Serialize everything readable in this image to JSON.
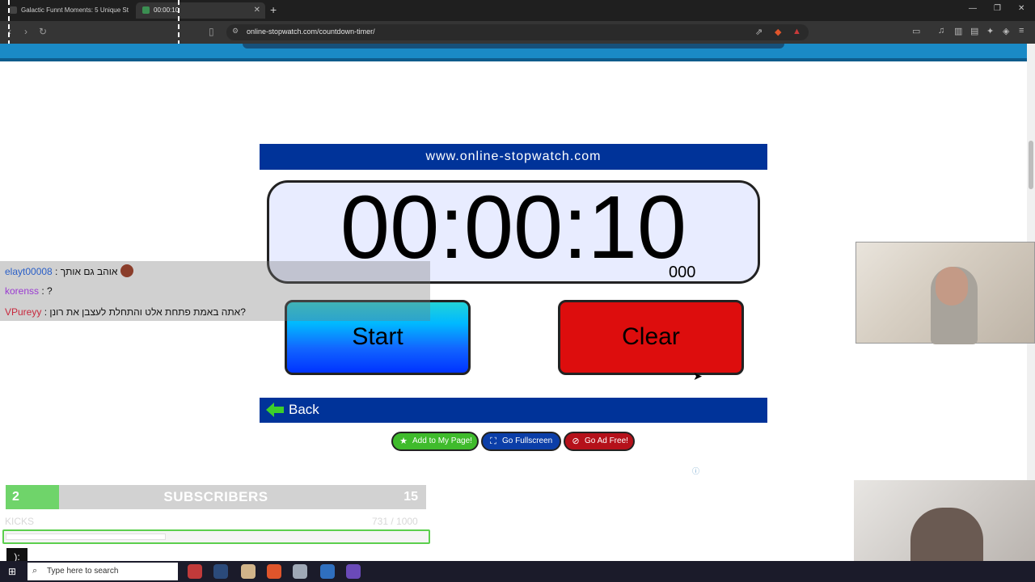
{
  "browser": {
    "tabs": [
      {
        "title": "Galactic Funnt Moments: 5 Unique St"
      },
      {
        "title": "00:00:10"
      }
    ],
    "new_tab_icon": "plus-icon",
    "url": "online-stopwatch.com/countdown-timer/"
  },
  "stopwatch": {
    "site_name": "www.online-stopwatch.com",
    "time": "00:00:10",
    "milliseconds": "000",
    "start_label": "Start",
    "clear_label": "Clear",
    "back_label": "Back",
    "add_label": "Add to My Page!",
    "fullscreen_label": "Go Fullscreen",
    "adfree_label": "Go Ad Free!",
    "colors": {
      "header": "#003399",
      "clear": "#dd0d0d",
      "start_top": "#22d3d8",
      "start_bottom": "#0033ff"
    }
  },
  "chat": {
    "messages": [
      {
        "nick": "elayt00008",
        "text": " : אוהב גם אותך",
        "nick_color": "#2a5fc7"
      },
      {
        "nick": "korenss",
        "text": " : ?",
        "nick_color": "#9a3bd1"
      },
      {
        "nick": "VPureyy",
        "text": " : אתה באמת פתחת אלט והתחלת לעצבן את רונן?",
        "nick_color": "#c8283d"
      }
    ]
  },
  "subscribers": {
    "current": "2",
    "label": "SUBSCRIBERS",
    "goal": "15"
  },
  "kicks": {
    "label": "KICKS",
    "count": "731 / 1000",
    "progress": 0.731
  },
  "overlay": {
    "kaomoji": "):"
  },
  "taskbar": {
    "search_placeholder": "Type here to search"
  }
}
